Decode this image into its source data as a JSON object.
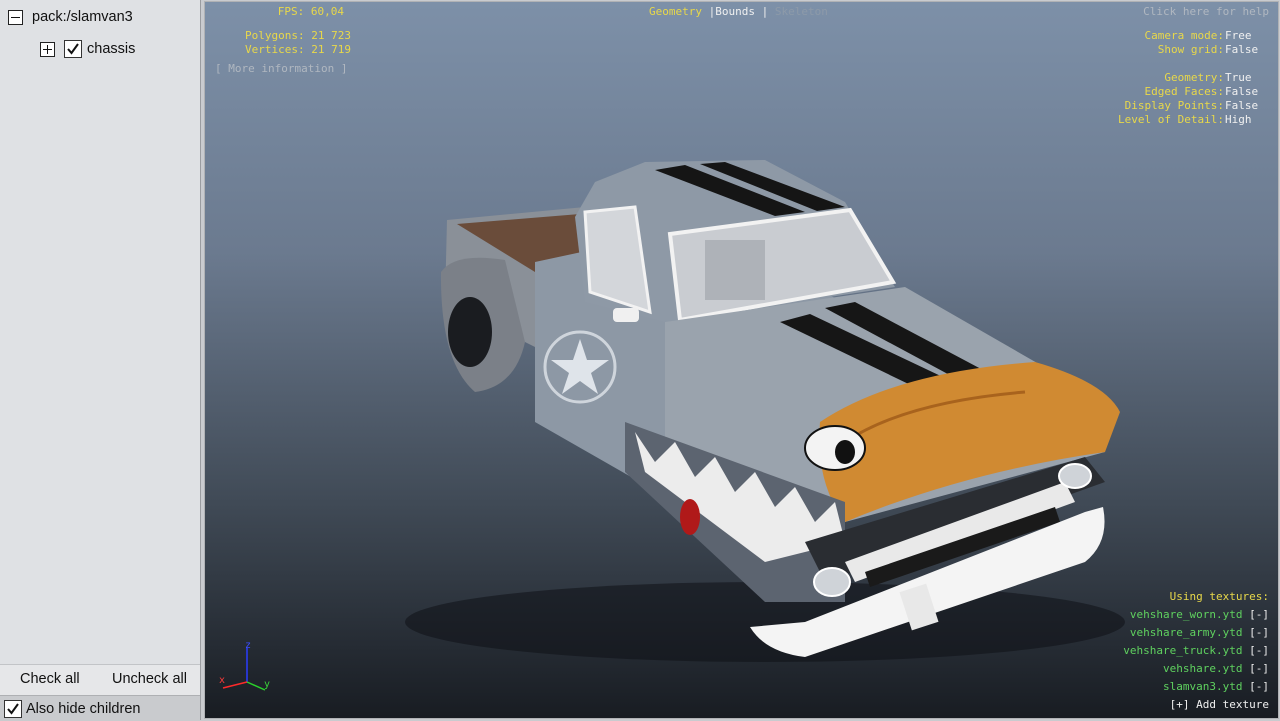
{
  "tree": {
    "root_label": "pack:/slamvan3",
    "child_label": "chassis"
  },
  "buttons": {
    "check_all": "Check all",
    "uncheck_all": "Uncheck all",
    "hide_children": "Also hide children"
  },
  "overlay": {
    "fps": "FPS: 60,04",
    "polygons": "Polygons: 21 723",
    "vertices": "Vertices: 21 719",
    "more_info": "[ More information ]",
    "mode_geometry": "Geometry",
    "mode_sep1": "|",
    "mode_bounds": "Bounds",
    "mode_sep2": "|",
    "mode_skeleton": "Skeleton",
    "help": "Click here for help",
    "settings": [
      {
        "label": "Camera mode:",
        "value": "Free"
      },
      {
        "label": "Show grid:",
        "value": "False"
      },
      {
        "label": "Geometry:",
        "value": "True"
      },
      {
        "label": "Edged Faces:",
        "value": "False"
      },
      {
        "label": "Display Points:",
        "value": "False"
      },
      {
        "label": "Level of Detail:",
        "value": "High"
      }
    ],
    "textures_title": "Using textures:",
    "textures": [
      {
        "name": "vehshare_worn.ytd",
        "action": "[-]"
      },
      {
        "name": "vehshare_army.ytd",
        "action": "[-]"
      },
      {
        "name": "vehshare_truck.ytd",
        "action": "[-]"
      },
      {
        "name": "vehshare.ytd",
        "action": "[-]"
      },
      {
        "name": "slamvan3.ytd",
        "action": "[-]"
      }
    ],
    "add_texture": "[+] Add texture"
  },
  "gizmo": {
    "x": "x",
    "y": "y",
    "z": "z"
  },
  "colors": {
    "accent_yellow": "#e8d84a",
    "texture_green": "#5fd15f",
    "rust_orange": "#d08a32"
  }
}
